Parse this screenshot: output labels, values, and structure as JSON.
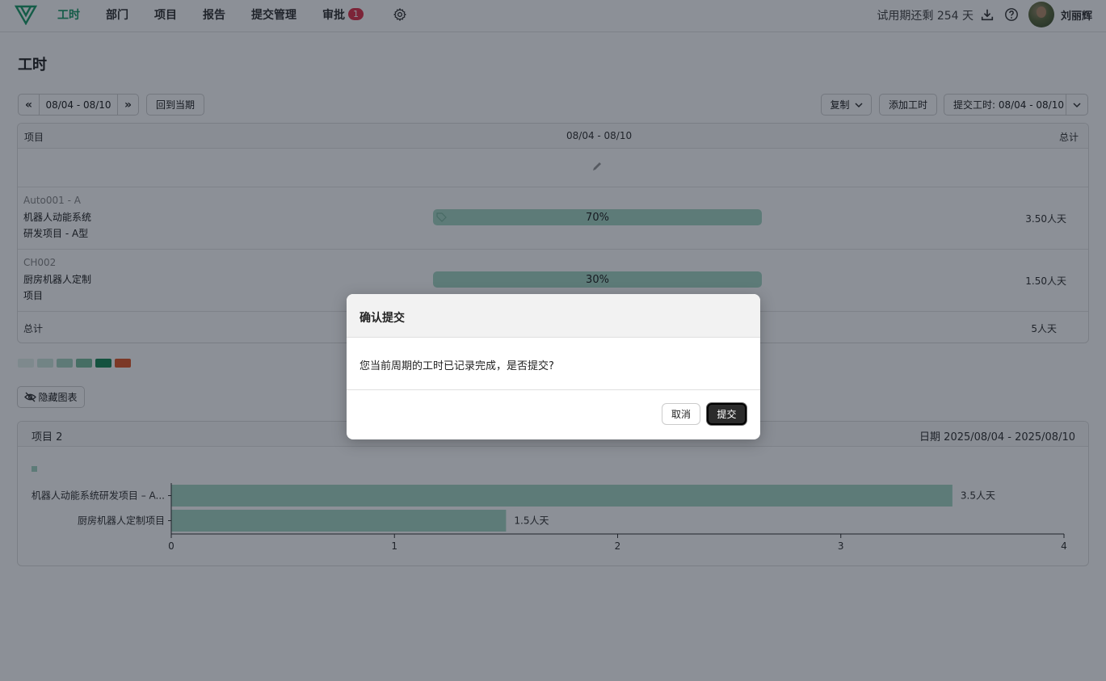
{
  "nav": {
    "items": [
      {
        "label": "工时",
        "active": true
      },
      {
        "label": "部门"
      },
      {
        "label": "项目"
      },
      {
        "label": "报告"
      },
      {
        "label": "提交管理"
      },
      {
        "label": "审批"
      }
    ],
    "approval_badge": "1",
    "trial_text": "试用期还剩 254 天",
    "username": "刘丽辉",
    "icons": [
      "logo-icon",
      "gear-icon",
      "download-icon",
      "help-icon",
      "avatar"
    ]
  },
  "page": {
    "title": "工时"
  },
  "toolbar": {
    "prev_label": "«",
    "period": "08/04 - 08/10",
    "next_label": "»",
    "current_period_label": "回到当期",
    "copy_label": "复制",
    "add_label": "添加工时",
    "submit_label": "提交工时: 08/04 - 08/10"
  },
  "table": {
    "headers": {
      "project": "项目",
      "period": "08/04 - 08/10",
      "total": "总计"
    },
    "rows": [
      {
        "code": "Auto001 - A",
        "name_line1": "机器人动能系统",
        "name_line2": "研发项目 - A型",
        "percent": "70%",
        "percent_value": 0.7,
        "total": "3.50人天"
      },
      {
        "code": "CH002",
        "name_line1": "厨房机器人定制",
        "name_line2": "项目",
        "percent": "30%",
        "percent_value": 0.3,
        "total": "1.50人天"
      }
    ],
    "footer": {
      "label": "总计",
      "total": "5人天"
    }
  },
  "legend_colors": [
    "#e4f2ec",
    "#cfe8de",
    "#a9d6c3",
    "#7cbf9f",
    "#1e8a5a",
    "#e05a2a"
  ],
  "chart_toggle": {
    "label": "隐藏图表"
  },
  "chart_card": {
    "left_title": "项目 2",
    "right_title": "日期 2025/08/04 - 2025/08/10"
  },
  "chart_data": {
    "type": "bar",
    "orientation": "horizontal",
    "categories": [
      "机器人动能系统研发项目 – A...",
      "厨房机器人定制项目"
    ],
    "values": [
      3.5,
      1.5
    ],
    "value_labels": [
      "3.5人天",
      "1.5人天"
    ],
    "xlim": [
      0,
      4
    ],
    "ticks": [
      0,
      1,
      2,
      3,
      4
    ],
    "color": "#a6d8c4"
  },
  "modal": {
    "title": "确认提交",
    "message": "您当前周期的工时已记录完成，是否提交?",
    "cancel_label": "取消",
    "submit_label": "提交"
  }
}
